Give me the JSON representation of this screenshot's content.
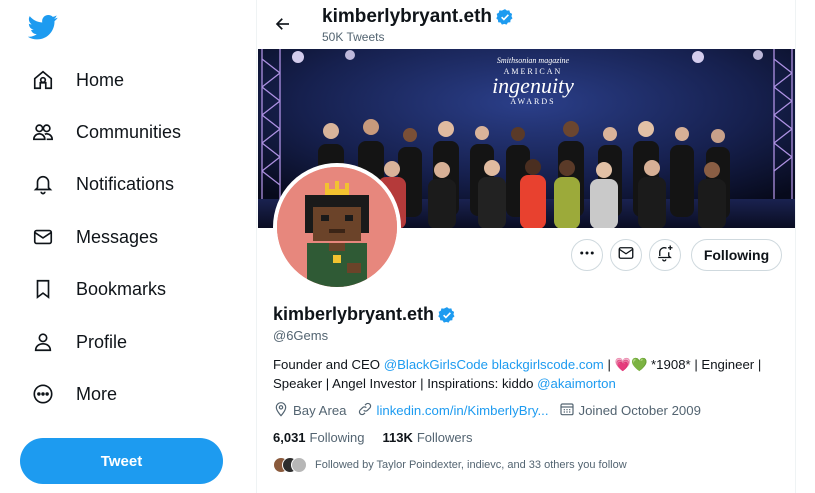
{
  "sidebar": {
    "items": [
      {
        "label": "Home",
        "icon": "home-icon"
      },
      {
        "label": "Communities",
        "icon": "communities-icon"
      },
      {
        "label": "Notifications",
        "icon": "bell-icon"
      },
      {
        "label": "Messages",
        "icon": "envelope-icon"
      },
      {
        "label": "Bookmarks",
        "icon": "bookmark-icon"
      },
      {
        "label": "Profile",
        "icon": "person-icon"
      },
      {
        "label": "More",
        "icon": "more-circle-icon"
      }
    ],
    "tweet_label": "Tweet"
  },
  "header": {
    "name": "kimberlybryant.eth",
    "tweet_count": "50K Tweets"
  },
  "banner": {
    "sign_line1": "Smithsonian magazine",
    "sign_line2": "AMERICAN",
    "sign_line3": "ingenuity",
    "sign_line4": "AWARDS"
  },
  "profile": {
    "name": "kimberlybryant.eth",
    "handle": "@6Gems",
    "bio": {
      "t1": "Founder and CEO ",
      "l1": "@BlackGirlsCode",
      "t2": " ",
      "l2": "blackgirlscode.com",
      "t3": " | ",
      "emoji": "💗💚",
      "t4": " *1908* | Engineer | Speaker | Angel Investor | Inspirations: kiddo ",
      "l3": "@akaimorton"
    },
    "location": "Bay Area",
    "website": "linkedin.com/in/KimberlyBry...",
    "joined": "Joined October 2009",
    "following_count": "6,031",
    "following_label": "Following",
    "followers_count": "113K",
    "followers_label": "Followers",
    "followed_by": "Followed by Taylor Poindexter, indievc, and 33 others you follow",
    "follow_button": "Following"
  },
  "colors": {
    "accent": "#1d9bf0",
    "text": "#0f1419",
    "muted": "#536471",
    "border": "#cfd9de"
  }
}
